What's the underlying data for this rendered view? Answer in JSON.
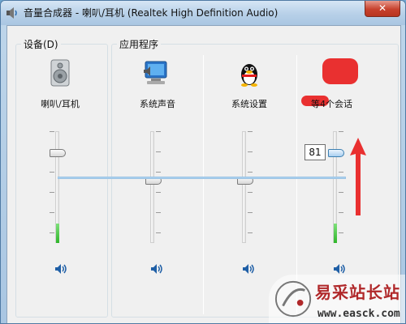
{
  "window": {
    "title": "音量合成器 - 喇叭/耳机 (Realtek High Definition Audio)",
    "close_label": "✕"
  },
  "groups": {
    "device_label": "设备(D)",
    "apps_label": "应用程序"
  },
  "columns": [
    {
      "name": "喇叭/耳机",
      "icon": "speaker-device-icon",
      "level_percent": 80
    },
    {
      "name": "系统声音",
      "icon": "system-sounds-icon",
      "level_percent": 50
    },
    {
      "name": "系统设置",
      "icon": "qq-penguin-icon",
      "level_percent": 50
    },
    {
      "name": "等4个会话",
      "icon": "redacted-app-icon",
      "level_percent": 81
    }
  ],
  "volume_tooltip": "81",
  "watermark": {
    "title": "易采站长站",
    "url": "www.easck.com"
  },
  "colors": {
    "meter_green": "#2fb52a",
    "annotation_red": "#e93030",
    "title_bar": "#b7d0e8"
  }
}
